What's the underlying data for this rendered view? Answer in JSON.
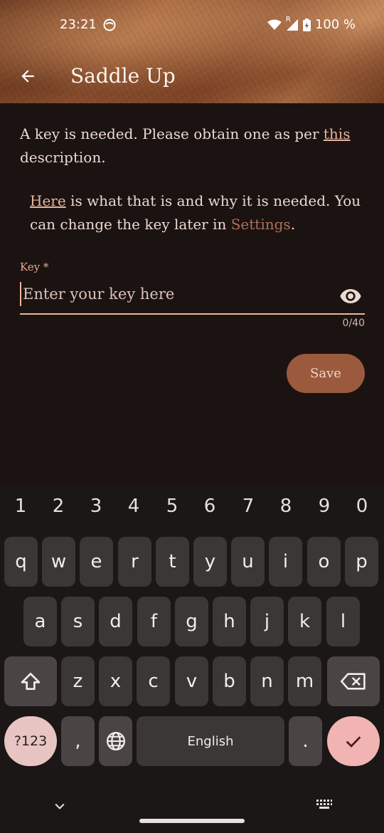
{
  "status_bar": {
    "time": "23:21",
    "battery": "100 %",
    "network_badge": "R"
  },
  "toolbar": {
    "title": "Saddle Up",
    "back_icon": "arrow-back-icon"
  },
  "content": {
    "para1_before": "A key is needed. Please obtain one as per ",
    "para1_link": "this",
    "para1_after": " description.",
    "para2_link": "Here",
    "para2_mid": " is what that is and why it is needed. You can change the key later in ",
    "para2_settings": "Settings",
    "para2_end": "."
  },
  "key_field": {
    "label": "Key *",
    "placeholder": "Enter your key here",
    "value": "",
    "counter": "0/40",
    "visibility_icon": "eye-icon"
  },
  "save_label": "Save",
  "colors": {
    "background": "#1b1311",
    "accent": "#9b5a3e",
    "link": "#e9b49c",
    "field_underline": "#f0b49c"
  },
  "keyboard": {
    "numbers": [
      "1",
      "2",
      "3",
      "4",
      "5",
      "6",
      "7",
      "8",
      "9",
      "0"
    ],
    "row1": [
      "q",
      "w",
      "e",
      "r",
      "t",
      "y",
      "u",
      "i",
      "o",
      "p"
    ],
    "row2": [
      "a",
      "s",
      "d",
      "f",
      "g",
      "h",
      "j",
      "k",
      "l"
    ],
    "row3": [
      "z",
      "x",
      "c",
      "v",
      "b",
      "n",
      "m"
    ],
    "symbols_label": "?123",
    "comma": ",",
    "space_label": "English",
    "period": "."
  }
}
